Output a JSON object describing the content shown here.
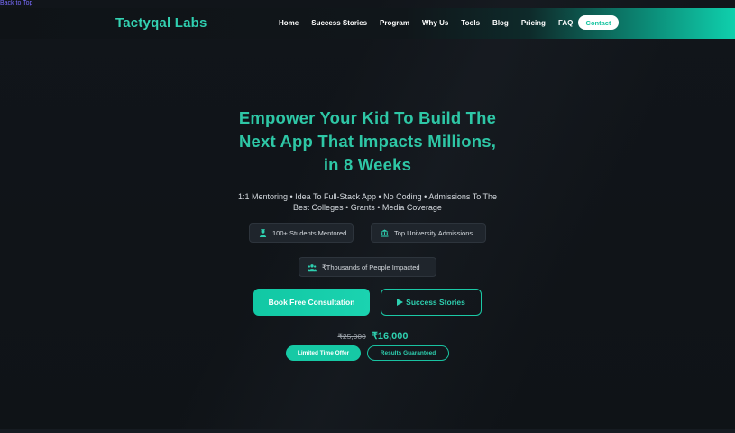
{
  "back_to_top": "Back to Top",
  "brand": {
    "name_part1": "Tactyqal",
    "name_part2": "Labs"
  },
  "nav": {
    "items": [
      "Home",
      "Success Stories",
      "Program",
      "Why Us",
      "Tools",
      "Blog",
      "Pricing",
      "FAQ"
    ],
    "contact": "Contact"
  },
  "hero": {
    "title_lines": [
      "Empower Your Kid To Build The",
      "Next App That Impacts Millions,",
      "in 8 Weeks"
    ],
    "subtitle_lines": [
      "1:1 Mentoring • Idea To Full-Stack App • No Coding • Admissions To The",
      "Best Colleges • Grants • Media Coverage"
    ]
  },
  "stats": [
    {
      "icon": "graduate-icon",
      "label": "100+ Students Mentored"
    },
    {
      "icon": "university-icon",
      "label": "Top University Admissions"
    },
    {
      "icon": "users-icon",
      "label": "₹Thousands of People Impacted"
    }
  ],
  "cta": {
    "primary": "Book Free Consultation",
    "secondary": "Success Stories"
  },
  "pricing": {
    "old_price": "₹25,000",
    "new_price": "₹16,000",
    "badge_offer": "Limited Time Offer",
    "badge_guarantee": "Results Guaranteed"
  },
  "colors": {
    "accent": "#2ec7a6",
    "background": "#0f1216",
    "link": "#7a6cff"
  }
}
